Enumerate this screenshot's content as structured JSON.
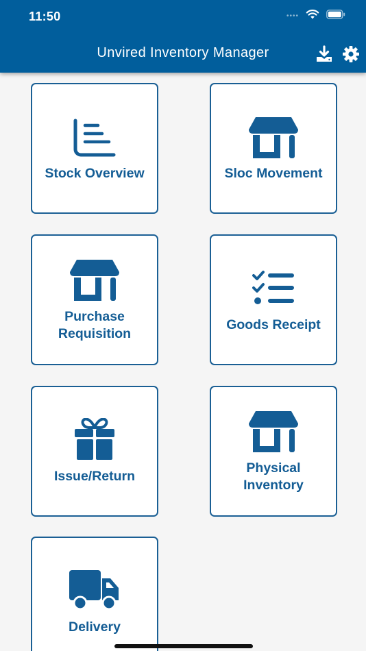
{
  "status_bar": {
    "time": "11:50"
  },
  "header": {
    "title": "Unvired Inventory Manager"
  },
  "tiles": [
    {
      "label": "Stock Overview",
      "icon": "chart-bars-icon"
    },
    {
      "label": "Sloc Movement",
      "icon": "storefront-icon"
    },
    {
      "label": "Purchase\nRequisition",
      "icon": "storefront-icon"
    },
    {
      "label": "Goods Receipt",
      "icon": "checklist-icon"
    },
    {
      "label": "Issue/Return",
      "icon": "gift-icon"
    },
    {
      "label": "Physical\nInventory",
      "icon": "storefront-icon"
    },
    {
      "label": "Delivery",
      "icon": "truck-icon"
    }
  ],
  "colors": {
    "header_bg": "#015e9c",
    "accent": "#145d95",
    "background": "#f5f5f5"
  }
}
